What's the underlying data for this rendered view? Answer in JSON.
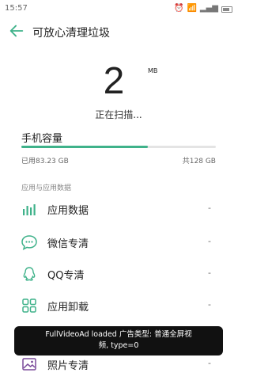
{
  "status_bar": {
    "time": "15:57"
  },
  "header": {
    "title": "可放心清理垃圾"
  },
  "scan": {
    "amount": "2",
    "unit": "MB",
    "status": "正在扫描..."
  },
  "capacity": {
    "title": "手机容量",
    "used": "已用83.23 GB",
    "total": "共128 GB",
    "used_fraction": 0.65
  },
  "section_title": "应用与应用数据",
  "items": [
    {
      "label": "应用数据",
      "value": "-",
      "icon": "bar-chart-icon"
    },
    {
      "label": "微信专清",
      "value": "-",
      "icon": "chat-bubble-icon"
    },
    {
      "label": "QQ专清",
      "value": "-",
      "icon": "qq-penguin-icon"
    },
    {
      "label": "应用卸载",
      "value": "-",
      "icon": "app-grid-icon"
    },
    {
      "label": "照片专清",
      "value": "-",
      "icon": "photo-icon"
    }
  ],
  "toast": {
    "line1": "FullVideoAd loaded  广告类型: 普通全屏视",
    "line2": "频, type=0"
  },
  "colors": {
    "accent": "#3fb28a",
    "toast_bg": "#111111"
  }
}
